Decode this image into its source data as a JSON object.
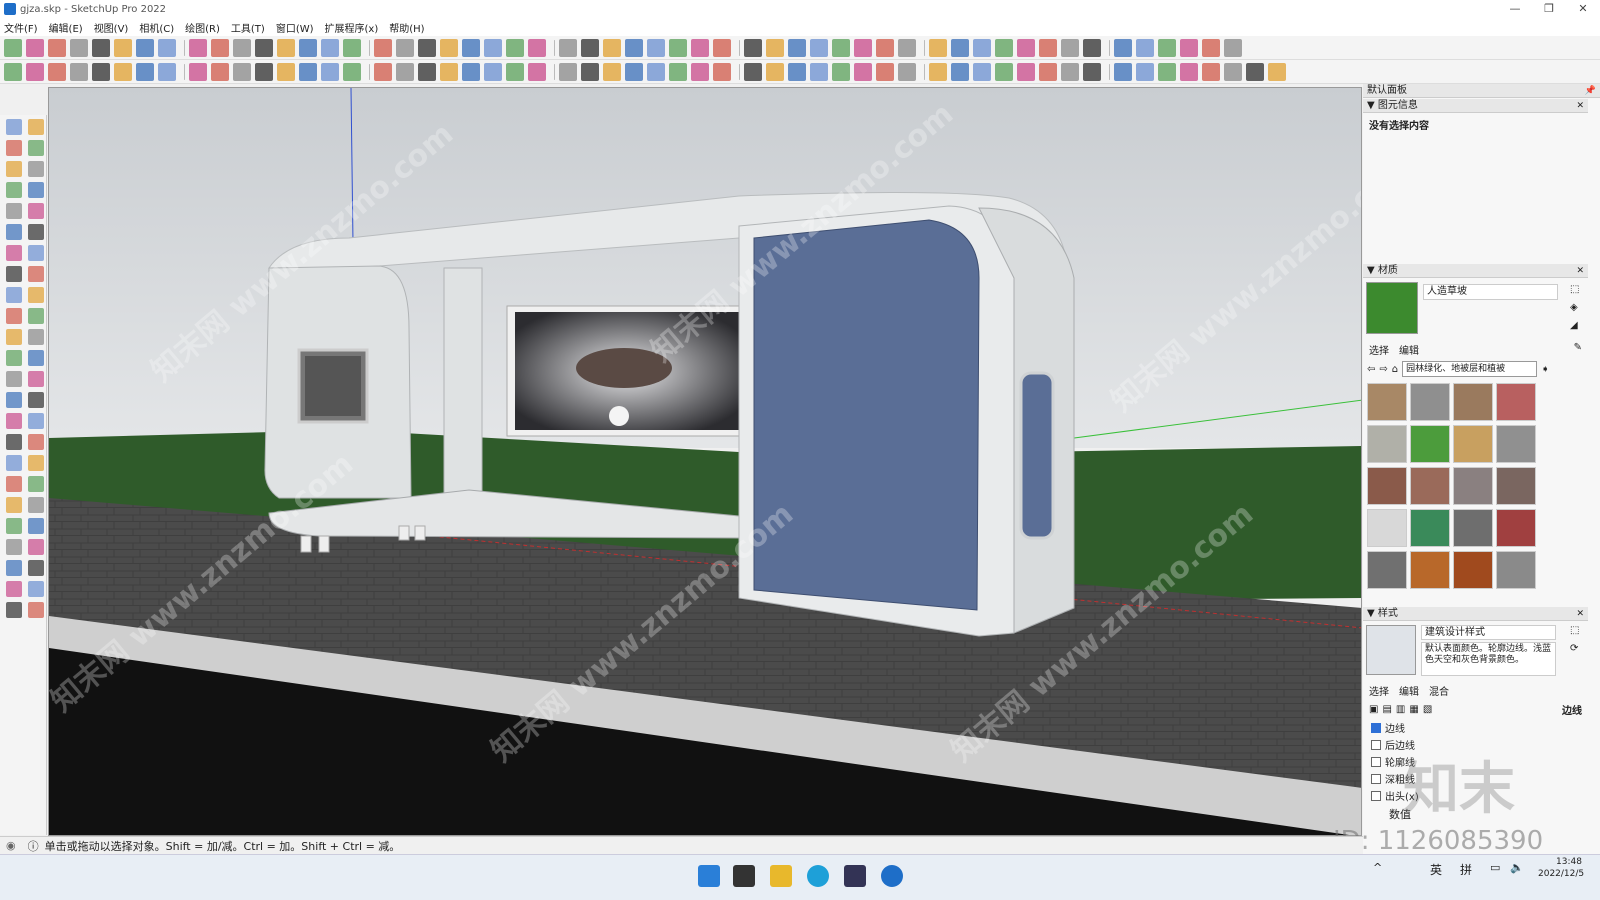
{
  "window": {
    "title": "gjza.skp - SketchUp Pro 2022",
    "controls": [
      "—",
      "❐",
      "✕"
    ]
  },
  "menu": [
    "文件(F)",
    "编辑(E)",
    "视图(V)",
    "相机(C)",
    "绘图(R)",
    "工具(T)",
    "窗口(W)",
    "扩展程序(x)",
    "帮助(H)"
  ],
  "tray": {
    "title": "默认面板",
    "entity_info": {
      "header": "图元信息",
      "value": "没有选择内容"
    },
    "materials": {
      "header": "材质",
      "name": "人造草坡",
      "tabs": [
        "选择",
        "编辑"
      ],
      "library": "园林绿化、地被层和植被"
    },
    "styles": {
      "header": "样式",
      "name": "建筑设计样式",
      "description": "默认表面颜色。轮廓边线。浅蓝色天空和灰色背景颜色。",
      "tabs": [
        "选择",
        "编辑",
        "混合"
      ],
      "right_label": "边线",
      "options": [
        {
          "label": "边线",
          "checked": true
        },
        {
          "label": "后边线",
          "checked": false
        },
        {
          "label": "轮廓线",
          "checked": false
        },
        {
          "label": "深粗线",
          "checked": false
        },
        {
          "label": "出头(x)",
          "checked": false
        }
      ],
      "bottom_label": "数值"
    }
  },
  "status": {
    "hint": "单击或拖动以选择对象。Shift = 加/减。Ctrl = 加。Shift + Ctrl = 减。"
  },
  "taskbar": {
    "lang1": "英",
    "lang2": "拼",
    "time": "13:48",
    "date": "2022/12/5"
  },
  "watermarks": {
    "site": "知末网 www.znzmo.com",
    "brand": "知末",
    "id": "ID: 1126085390"
  },
  "colors": {
    "sky": "#d9dcdf",
    "grass": "#2f5b2a",
    "pavement": "#4a4a4a",
    "panel_blue": "#5a6e96",
    "accent": "#2d6fd6"
  }
}
